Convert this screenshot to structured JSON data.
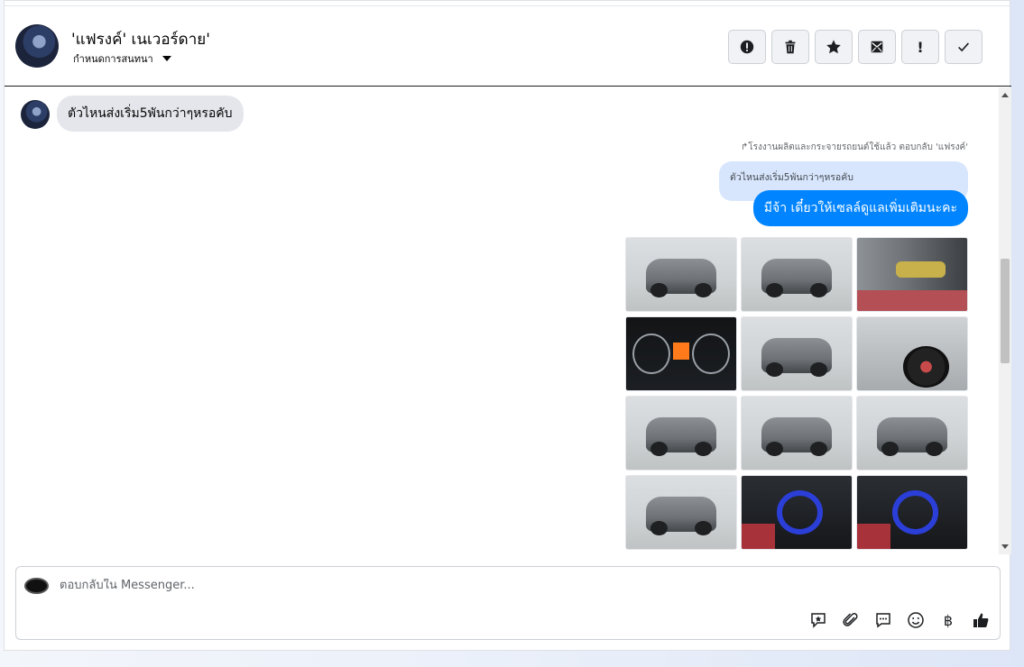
{
  "header": {
    "contact_name": "'แฟรงค์' เนเวอร์ดาย'",
    "assign_label": "กำหนดการสนทนา",
    "toolbar": [
      {
        "name": "flag-spam-button",
        "icon": "alert-circle-icon",
        "label": ""
      },
      {
        "name": "delete-button",
        "icon": "trash-icon",
        "label": ""
      },
      {
        "name": "star-button",
        "icon": "star-icon",
        "label": ""
      },
      {
        "name": "mark-unread-button",
        "icon": "envelope-icon",
        "label": ""
      },
      {
        "name": "mark-important-button",
        "icon": "exclamation-icon",
        "label": "!"
      },
      {
        "name": "mark-done-button",
        "icon": "check-icon",
        "label": ""
      }
    ]
  },
  "conversation": {
    "incoming_message": "ตัวไหนส่งเริ่ม5พันกว่าๆหรอคับ",
    "reply_meta": "โรงงานผลิตและกระจายรถยนต์ใช้แล้ว ตอบกลับ 'แฟรงค์'",
    "quoted_text": "ตัวไหนส่งเริ่ม5พันกว่าๆหรอคับ",
    "outgoing_message": "มีจ้า เดี๋ยวให้เซลล์ดูแลเพิ่มเติมนะคะ",
    "photos": [
      {
        "kind": "front"
      },
      {
        "kind": "front"
      },
      {
        "kind": "door"
      },
      {
        "kind": "dash"
      },
      {
        "kind": "side"
      },
      {
        "kind": "wheel"
      },
      {
        "kind": "front"
      },
      {
        "kind": "rear"
      },
      {
        "kind": "rear"
      },
      {
        "kind": "rear"
      },
      {
        "kind": "interior"
      },
      {
        "kind": "interior"
      }
    ]
  },
  "composer": {
    "placeholder": "ตอบกลับใน Messenger...",
    "value": "",
    "tools": [
      "saved-reply-icon",
      "paperclip-icon",
      "chat-bubble-icon",
      "emoji-icon",
      "baht-icon",
      "thumbs-up-icon"
    ],
    "baht_symbol": "฿"
  },
  "colors": {
    "outgoing_bubble": "#0084ff",
    "incoming_bubble": "#e4e6eb",
    "quoted_bubble": "#d8e6fd"
  }
}
